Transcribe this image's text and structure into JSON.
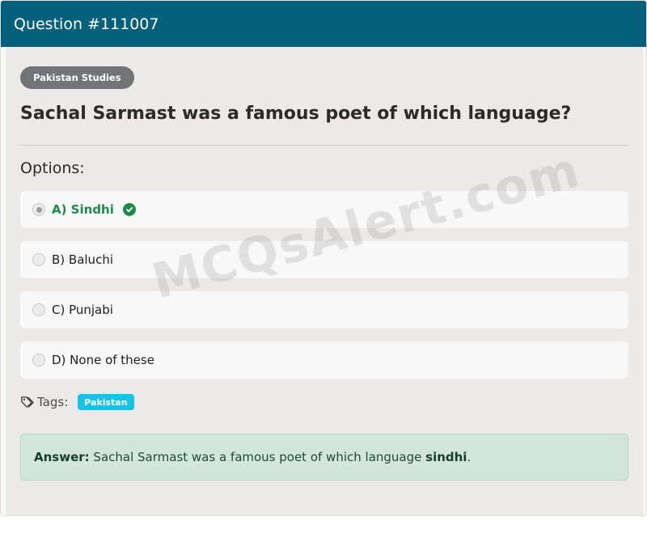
{
  "header": {
    "title": "Question #111007"
  },
  "category": {
    "label": "Pakistan Studies"
  },
  "question": {
    "text": "Sachal Sarmast was a famous poet of which language?"
  },
  "options_label": "Options:",
  "options": [
    {
      "label": "A) Sindhi",
      "selected": true,
      "correct": true
    },
    {
      "label": "B) Baluchi",
      "selected": false,
      "correct": false
    },
    {
      "label": "C) Punjabi",
      "selected": false,
      "correct": false
    },
    {
      "label": "D) None of these",
      "selected": false,
      "correct": false
    }
  ],
  "tags": {
    "label": "Tags:",
    "items": [
      "Pakistan"
    ]
  },
  "answer": {
    "prefix": "Answer:",
    "text": " Sachal Sarmast was a famous poet of which language ",
    "highlight": "sindhi",
    "suffix": "."
  },
  "watermark": {
    "text": "MCQsAlert.com"
  },
  "colors": {
    "header_bg": "#02607a",
    "badge_bg": "#727478",
    "correct_green": "#1e8a4a",
    "tag_bg": "#13c3ea",
    "answer_bg": "#d2e6dc"
  }
}
